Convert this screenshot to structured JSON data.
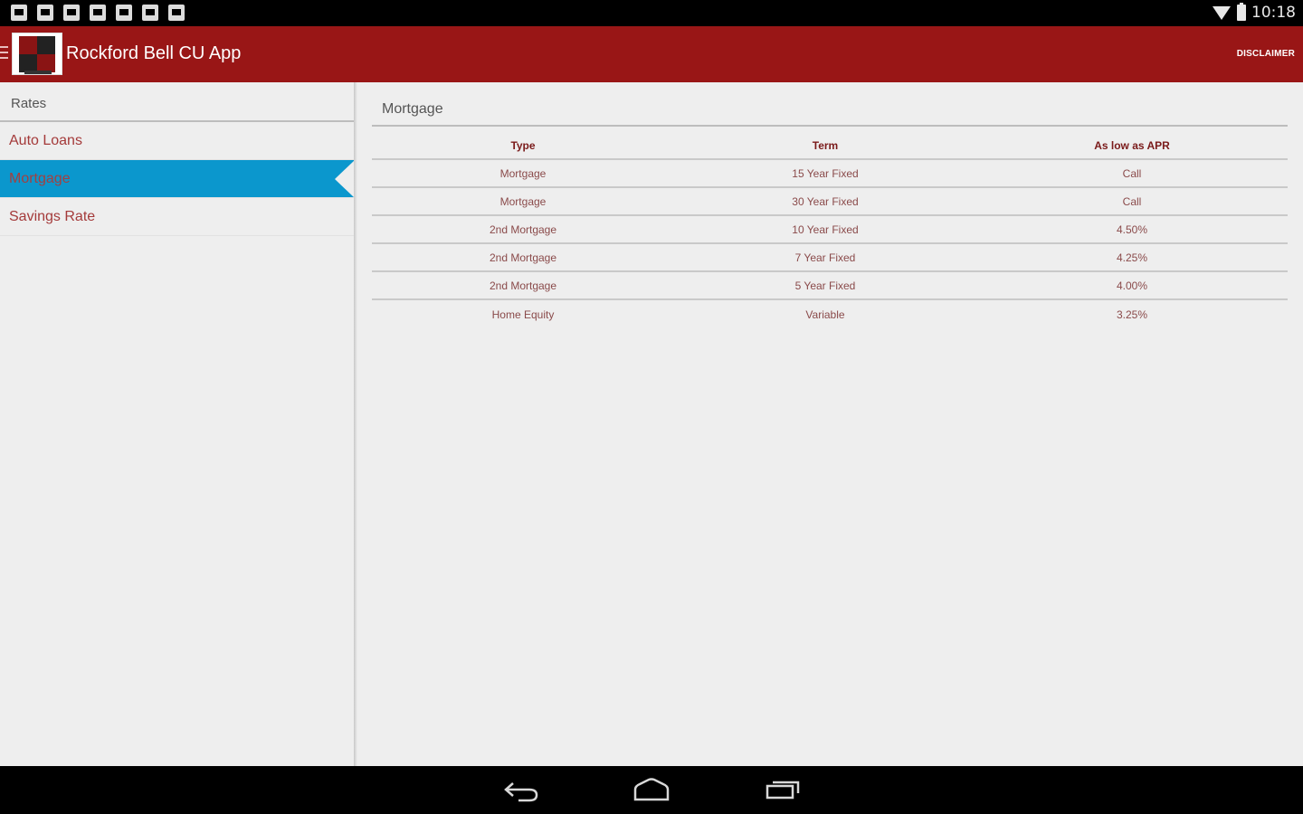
{
  "status_bar": {
    "notification_icons": [
      "phone-icon",
      "mail-icon",
      "image-icon",
      "mail-icon",
      "mail-icon",
      "bag-icon",
      "play-icon"
    ],
    "clock": "10:18"
  },
  "action_bar": {
    "title": "Rockford Bell CU App",
    "disclaimer_label": "DISCLAIMER",
    "brand_color": "#991616"
  },
  "sidebar": {
    "header": "Rates",
    "items": [
      {
        "label": "Auto Loans",
        "selected": false
      },
      {
        "label": "Mortgage",
        "selected": true
      },
      {
        "label": "Savings Rate",
        "selected": false
      }
    ],
    "selected_color": "#0b97cd"
  },
  "main": {
    "title": "Mortgage",
    "table": {
      "columns": [
        "Type",
        "Term",
        "As low as APR"
      ],
      "rows": [
        [
          "Mortgage",
          "15 Year Fixed",
          "Call"
        ],
        [
          "Mortgage",
          "30 Year Fixed",
          "Call"
        ],
        [
          "2nd Mortgage",
          "10 Year Fixed",
          "4.50%"
        ],
        [
          "2nd Mortgage",
          "7 Year Fixed",
          "4.25%"
        ],
        [
          "2nd Mortgage",
          "5 Year Fixed",
          "4.00%"
        ],
        [
          "Home Equity",
          "Variable",
          "3.25%"
        ]
      ]
    }
  },
  "nav_bar": {
    "buttons": [
      "back-icon",
      "home-icon",
      "recents-icon"
    ]
  }
}
